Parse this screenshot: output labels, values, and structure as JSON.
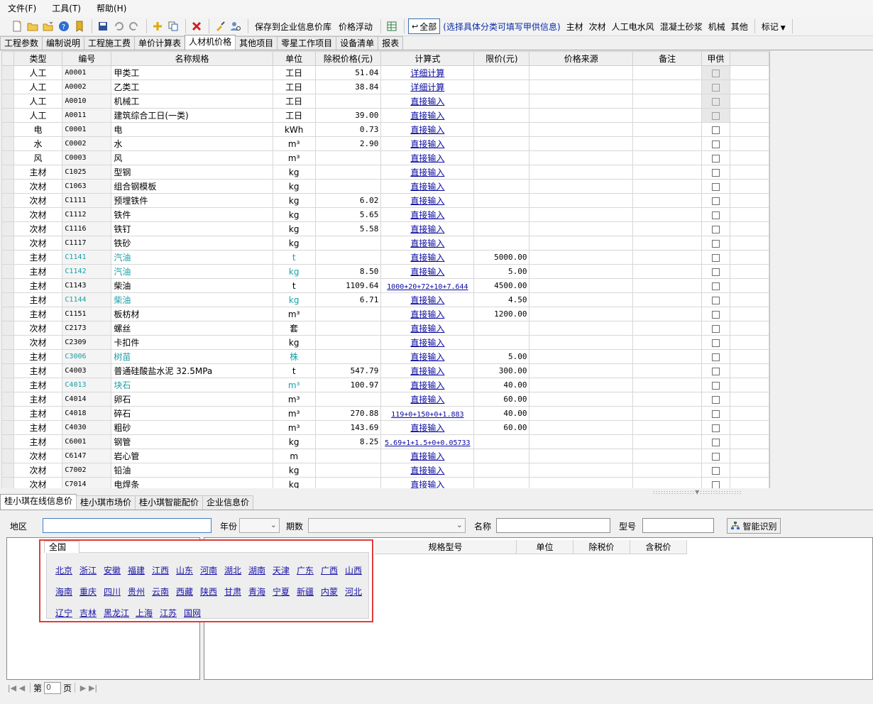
{
  "menu": [
    "文件(F)",
    "工具(T)",
    "帮助(H)"
  ],
  "toolbar": {
    "save_to_enterprise": "保存到企业信息价库",
    "price_float": "价格浮动",
    "all": "全部",
    "hint": "(选择具体分类可填写甲供信息)",
    "filters": [
      "主材",
      "次材",
      "人工电水风",
      "混凝土砂浆",
      "机械",
      "其他"
    ],
    "mark": "标记"
  },
  "tabs": [
    "工程参数",
    "编制说明",
    "工程施工费",
    "单价计算表",
    "人材机价格",
    "其他项目",
    "零星工作项目",
    "设备清单",
    "报表"
  ],
  "active_tab": "人材机价格",
  "grid": {
    "columns": [
      "类型",
      "编号",
      "名称规格",
      "单位",
      "除税价格(元)",
      "计算式",
      "限价(元)",
      "价格来源",
      "备注",
      "甲供"
    ],
    "rows": [
      {
        "type": "人工",
        "code": "A0001",
        "name": "甲类工",
        "unit": "工日",
        "price": "51.04",
        "calc": "详细计算",
        "limit": "",
        "locked": true
      },
      {
        "type": "人工",
        "code": "A0002",
        "name": "乙类工",
        "unit": "工日",
        "price": "38.84",
        "calc": "详细计算",
        "limit": "",
        "locked": true
      },
      {
        "type": "人工",
        "code": "A0010",
        "name": "机械工",
        "unit": "工日",
        "price": "",
        "calc": "直接输入",
        "limit": "",
        "locked": true
      },
      {
        "type": "人工",
        "code": "A0011",
        "name": "建筑综合工日(一类)",
        "unit": "工日",
        "price": "39.00",
        "calc": "直接输入",
        "limit": "",
        "locked": true
      },
      {
        "type": "电",
        "code": "C0001",
        "name": "电",
        "unit": "kWh",
        "price": "0.73",
        "calc": "直接输入",
        "limit": ""
      },
      {
        "type": "水",
        "code": "C0002",
        "name": "水",
        "unit": "m³",
        "price": "2.90",
        "calc": "直接输入",
        "limit": ""
      },
      {
        "type": "风",
        "code": "C0003",
        "name": "风",
        "unit": "m³",
        "price": "",
        "calc": "直接输入",
        "limit": ""
      },
      {
        "type": "主材",
        "code": "C1025",
        "name": "型钢",
        "unit": "kg",
        "price": "",
        "calc": "直接输入",
        "limit": ""
      },
      {
        "type": "次材",
        "code": "C1063",
        "name": "组合钢模板",
        "unit": "kg",
        "price": "",
        "calc": "直接输入",
        "limit": ""
      },
      {
        "type": "次材",
        "code": "C1111",
        "name": "预埋铁件",
        "unit": "kg",
        "price": "6.02",
        "calc": "直接输入",
        "limit": ""
      },
      {
        "type": "次材",
        "code": "C1112",
        "name": "铁件",
        "unit": "kg",
        "price": "5.65",
        "calc": "直接输入",
        "limit": ""
      },
      {
        "type": "次材",
        "code": "C1116",
        "name": "铁钉",
        "unit": "kg",
        "price": "5.58",
        "calc": "直接输入",
        "limit": ""
      },
      {
        "type": "次材",
        "code": "C1117",
        "name": "铁砂",
        "unit": "kg",
        "price": "",
        "calc": "直接输入",
        "limit": ""
      },
      {
        "type": "主材",
        "code": "C1141",
        "name": "汽油",
        "unit": "t",
        "price": "",
        "calc": "直接输入",
        "limit": "5000.00",
        "teal": true
      },
      {
        "type": "主材",
        "code": "C1142",
        "name": "汽油",
        "unit": "kg",
        "price": "8.50",
        "calc": "直接输入",
        "limit": "5.00",
        "teal": true
      },
      {
        "type": "主材",
        "code": "C1143",
        "name": "柴油",
        "unit": "t",
        "price": "1109.64",
        "calc": "1000+20+72+10+7.644",
        "formula": true,
        "limit": "4500.00"
      },
      {
        "type": "主材",
        "code": "C1144",
        "name": "柴油",
        "unit": "kg",
        "price": "6.71",
        "calc": "直接输入",
        "limit": "4.50",
        "teal": true
      },
      {
        "type": "主材",
        "code": "C1151",
        "name": "板枋材",
        "unit": "m³",
        "price": "",
        "calc": "直接输入",
        "limit": "1200.00"
      },
      {
        "type": "次材",
        "code": "C2173",
        "name": "螺丝",
        "unit": "套",
        "price": "",
        "calc": "直接输入",
        "limit": ""
      },
      {
        "type": "次材",
        "code": "C2309",
        "name": "卡扣件",
        "unit": "kg",
        "price": "",
        "calc": "直接输入",
        "limit": ""
      },
      {
        "type": "主材",
        "code": "C3006",
        "name": "树苗",
        "unit": "株",
        "price": "",
        "calc": "直接输入",
        "limit": "5.00",
        "teal": true
      },
      {
        "type": "主材",
        "code": "C4003",
        "name": "普通硅酸盐水泥 32.5MPa",
        "unit": "t",
        "price": "547.79",
        "calc": "直接输入",
        "limit": "300.00"
      },
      {
        "type": "主材",
        "code": "C4013",
        "name": "块石",
        "unit": "m³",
        "price": "100.97",
        "calc": "直接输入",
        "limit": "40.00",
        "teal": true
      },
      {
        "type": "主材",
        "code": "C4014",
        "name": "卵石",
        "unit": "m³",
        "price": "",
        "calc": "直接输入",
        "limit": "60.00"
      },
      {
        "type": "主材",
        "code": "C4018",
        "name": "碎石",
        "unit": "m³",
        "price": "270.88",
        "calc": "119+0+150+0+1.883",
        "formula": true,
        "limit": "40.00"
      },
      {
        "type": "主材",
        "code": "C4030",
        "name": "粗砂",
        "unit": "m³",
        "price": "143.69",
        "calc": "直接输入",
        "limit": "60.00"
      },
      {
        "type": "主材",
        "code": "C6001",
        "name": "钢管",
        "unit": "kg",
        "price": "8.25",
        "calc": "5.69+1+1.5+0+0.05733",
        "formula": true,
        "limit": ""
      },
      {
        "type": "次材",
        "code": "C6147",
        "name": "岩心管",
        "unit": "m",
        "price": "",
        "calc": "直接输入",
        "limit": ""
      },
      {
        "type": "次材",
        "code": "C7002",
        "name": "铅油",
        "unit": "kg",
        "price": "",
        "calc": "直接输入",
        "limit": ""
      },
      {
        "type": "次材",
        "code": "C7014",
        "name": "电焊条",
        "unit": "kg",
        "price": "",
        "calc": "直接输入",
        "limit": ""
      }
    ]
  },
  "bottom_tabs": [
    "桂小琪在线信息价",
    "桂小琪市场价",
    "桂小琪智能配价",
    "企业信息价"
  ],
  "filters": {
    "region_label": "地区",
    "year_label": "年份",
    "period_label": "期数",
    "name_label": "名称",
    "model_label": "型号",
    "smart_button": "智能识别"
  },
  "result_columns": [
    "规格型号",
    "单位",
    "除税价",
    "含税价"
  ],
  "region_popup": {
    "tab": "全国",
    "rows": [
      [
        "北京",
        "浙江",
        "安徽",
        "福建",
        "江西",
        "山东",
        "河南",
        "湖北",
        "湖南",
        "天津",
        "广东",
        "广西",
        "山西"
      ],
      [
        "海南",
        "重庆",
        "四川",
        "贵州",
        "云南",
        "西藏",
        "陕西",
        "甘肃",
        "青海",
        "宁夏",
        "新疆",
        "内蒙",
        "河北"
      ],
      [
        "辽宁",
        "吉林",
        "黑龙江",
        "上海",
        "江苏",
        "国网"
      ]
    ]
  },
  "pager": {
    "prefix": "第",
    "page": "0",
    "suffix": "页"
  }
}
